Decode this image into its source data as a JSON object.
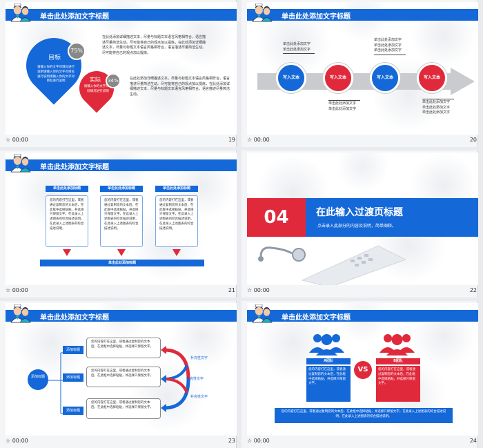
{
  "footer_time": "00:00",
  "slides": [
    {
      "number": "19",
      "title": "单击此处添加文字标题",
      "goal_label": "目标",
      "goal_percent": "75%",
      "goal_text": "请输入你的文字对目标进行说明请输入你的文字对目标进行说明请输入你的文字对目标进行说明",
      "actual_label": "实际",
      "actual_percent": "34%",
      "actual_text": "请输入你的文字对实际情况进行说明",
      "para1": "在此处添加详细描述文本，尽量与标题文本语言风格相符合，语言描述尽量简洁生动。尽可能将自己的观点加以提炼，在此处添加详细描述文本，尽量与标题文本语言风格相符合，语言描述尽量简洁生动。尽可能将自己的观点加以提炼。",
      "para2": "在此处添加详细描述文本，尽量与标题文本语言风格相符合，语言描述尽量简洁生动。尽可能将自己的观点加以提炼，在此处添加详细描述文本，尽量与标题文本语言风格相符合，语言描述尽量简洁生动。"
    },
    {
      "number": "20",
      "title": "单击此处添加文字标题",
      "node_label": "写入文本",
      "caption": "单击此处添加文字",
      "caption_short": "单击此处添加文字"
    },
    {
      "number": "21",
      "title": "单击此处添加文字标题",
      "col_title": "单击此处添加标题",
      "col_text": "您的内容打在这里，或者通过复制您的文本后，在此框中选择粘贴，并选择只保留文字。在此录入上述图表的综合描述说明，在此录入上述图表的综合描述说明。",
      "bottom_bar": "单击此处添加标题"
    },
    {
      "number": "22",
      "section_no": "04",
      "section_title": "在此输入过渡页标题",
      "section_sub": "点击录入此部分的内容及说明，简单阐释。"
    },
    {
      "number": "23",
      "title": "单击此处添加文字标题",
      "root_label": "添加标题",
      "branch_label": "添加标题",
      "box_text": "您的内容打在这里，或者通过复制您的文本后，在此框中选择粘贴，并选择只保留文字。",
      "side_label": "补充性文字"
    },
    {
      "number": "24",
      "title": "单击此处添加文字标题",
      "team_a": "A团队",
      "team_b": "B团队",
      "vs": "VS",
      "team_text": "您的内容打在这里，或者通过复制您的文本后，在此框中选择粘贴，并选择只保留文字。",
      "bottom_text": "您的内容打在这里，或者通过复制您的文本后，在此框中选择粘贴，并选择只保留文字。在此录入上述图表的综合描述说明，在此录入上述图表的综合描述说明。"
    }
  ],
  "colors": {
    "blue": "#1468d8",
    "red": "#e02a3b",
    "grey": "#888888"
  }
}
